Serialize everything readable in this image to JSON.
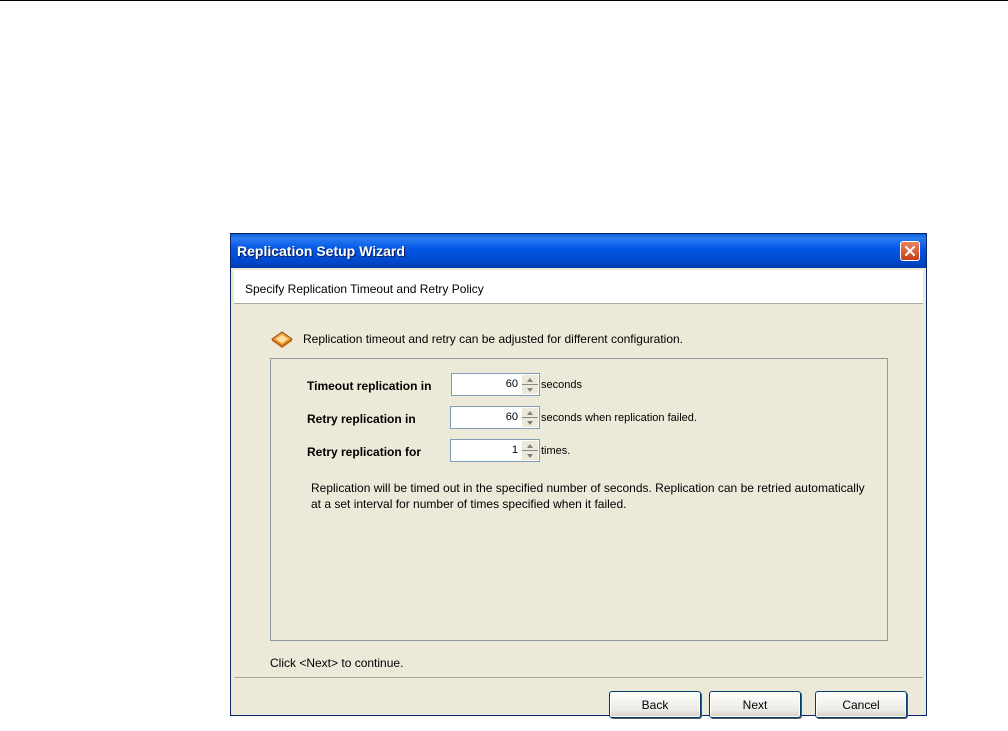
{
  "window": {
    "title": "Replication Setup Wizard",
    "header": "Specify Replication Timeout and Retry Policy"
  },
  "info": {
    "icon": "note-icon",
    "text": "Replication timeout and retry can be adjusted for different configuration."
  },
  "fields": [
    {
      "label": "Timeout replication in",
      "value": "60",
      "unit": "seconds"
    },
    {
      "label": "Retry replication in",
      "value": "60",
      "unit": "seconds when replication failed."
    },
    {
      "label": "Retry replication for",
      "value": "1",
      "unit": "times."
    }
  ],
  "description": "Replication will be timed out in the specified number of seconds. Replication can be retried automatically at a set interval for number of times specified when it failed.",
  "footer_hint": "Click <Next> to continue.",
  "buttons": {
    "back": "Back",
    "next": "Next",
    "cancel": "Cancel"
  },
  "colors": {
    "title_bar": "#0055E5",
    "dialog_bg": "#ECE9D8",
    "close_button": "#C4401A"
  }
}
